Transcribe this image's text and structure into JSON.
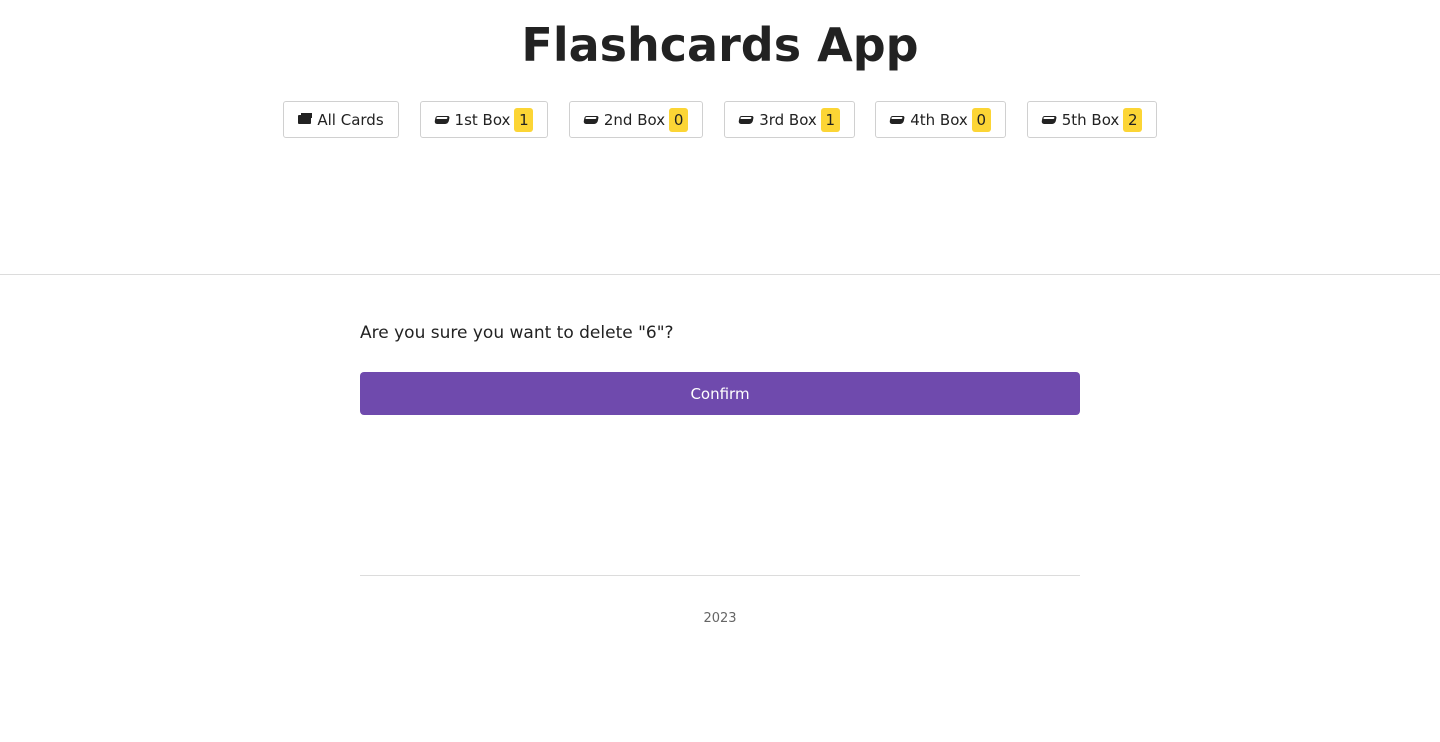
{
  "app": {
    "title": "Flashcards App"
  },
  "nav": {
    "items": [
      {
        "label": "All Cards",
        "icon": "cards-icon"
      },
      {
        "label": "1st Box",
        "icon": "box-icon",
        "count": "1"
      },
      {
        "label": "2nd Box",
        "icon": "box-icon",
        "count": "0"
      },
      {
        "label": "3rd Box",
        "icon": "box-icon",
        "count": "1"
      },
      {
        "label": "4th Box",
        "icon": "box-icon",
        "count": "0"
      },
      {
        "label": "5th Box",
        "icon": "box-icon",
        "count": "2"
      }
    ]
  },
  "dialog": {
    "question": "Are you sure you want to delete \"6\"?",
    "confirm_label": "Confirm"
  },
  "footer": {
    "year": "2023"
  },
  "colors": {
    "accent": "#6f4aad",
    "badge": "#fcd535",
    "text": "#222222",
    "divider": "#dcdcdc"
  }
}
